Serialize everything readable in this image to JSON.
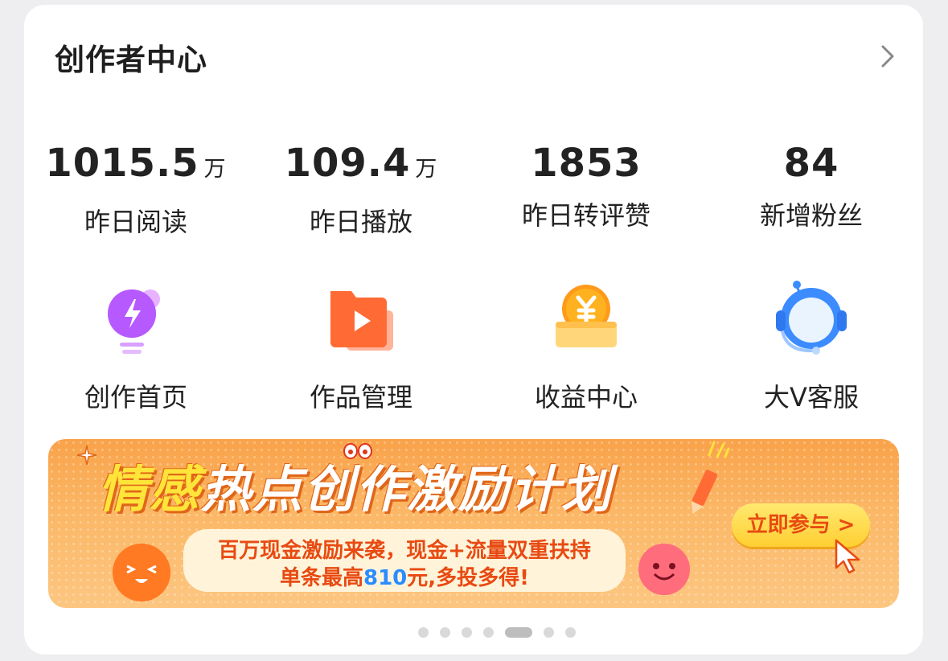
{
  "header": {
    "title": "创作者中心"
  },
  "stats": [
    {
      "value": "1015.5",
      "unit": "万",
      "label": "昨日阅读"
    },
    {
      "value": "109.4",
      "unit": "万",
      "label": "昨日播放"
    },
    {
      "value": "1853",
      "unit": "",
      "label": "昨日转评赞"
    },
    {
      "value": "84",
      "unit": "",
      "label": "新增粉丝"
    }
  ],
  "tools": [
    {
      "label": "创作首页",
      "icon": "lightbulb-bolt-icon"
    },
    {
      "label": "作品管理",
      "icon": "video-folder-icon"
    },
    {
      "label": "收益中心",
      "icon": "yen-coin-icon"
    },
    {
      "label": "大V客服",
      "icon": "headset-mascot-icon"
    }
  ],
  "banner": {
    "title_part1": "情感",
    "title_part2": "热点创作激励计划",
    "line1": "百万现金激励来袭，现金+流量双重扶持",
    "line2_prefix": "单条最高",
    "line2_highlight": "810",
    "line2_suffix": "元,多投多得!",
    "cta": "立即参与 >"
  },
  "pager": {
    "count": 7,
    "active_index": 4
  },
  "colors": {
    "accent_orange": "#e84a12",
    "banner_bg": "#f9a24a",
    "highlight_blue": "#2a8cff"
  }
}
